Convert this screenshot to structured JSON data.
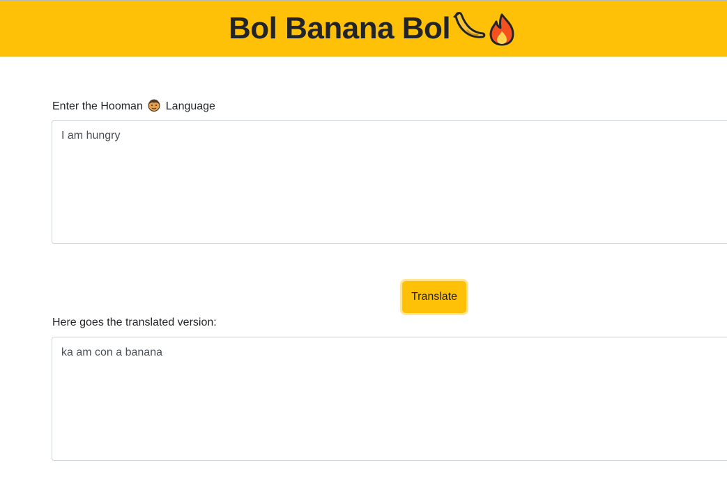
{
  "header": {
    "title": "Bol Banana Bol",
    "icons": [
      "banana-icon",
      "fire-icon"
    ],
    "background_color": "#ffc107"
  },
  "input_section": {
    "label_before": "Enter the Hooman",
    "label_icon": "person-face-icon",
    "label_after": "Language",
    "value": "I am hungry"
  },
  "translate_button": {
    "label": "Translate"
  },
  "output_section": {
    "label": "Here goes the translated version:",
    "value": "ka am con a banana"
  }
}
